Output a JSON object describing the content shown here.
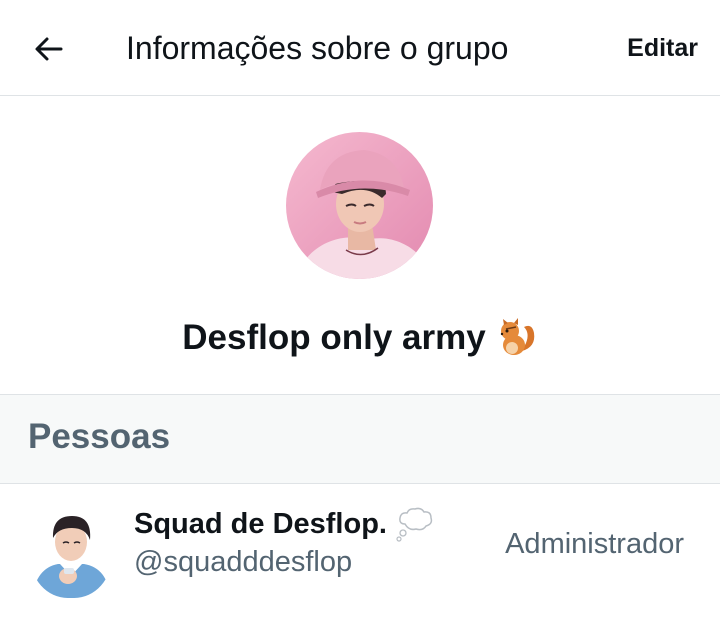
{
  "header": {
    "back_icon": "arrow-left-icon",
    "title": "Informações sobre o grupo",
    "edit_label": "Editar"
  },
  "group": {
    "avatar_description_icon": "group-avatar",
    "name": "Desflop only army",
    "name_emoji_icon": "chipmunk-emoji-icon"
  },
  "people_section": {
    "title": "Pessoas"
  },
  "members": [
    {
      "display_name": "Squad de Desflop.",
      "name_emoji_icon": "thought-balloon-emoji-icon",
      "handle": "@squadddesflop",
      "role": "Administrador"
    }
  ],
  "colors": {
    "primary_text": "#0f1419",
    "secondary_text": "#536471",
    "divider": "#dfe3e6",
    "section_bg": "#f7f9f9"
  }
}
